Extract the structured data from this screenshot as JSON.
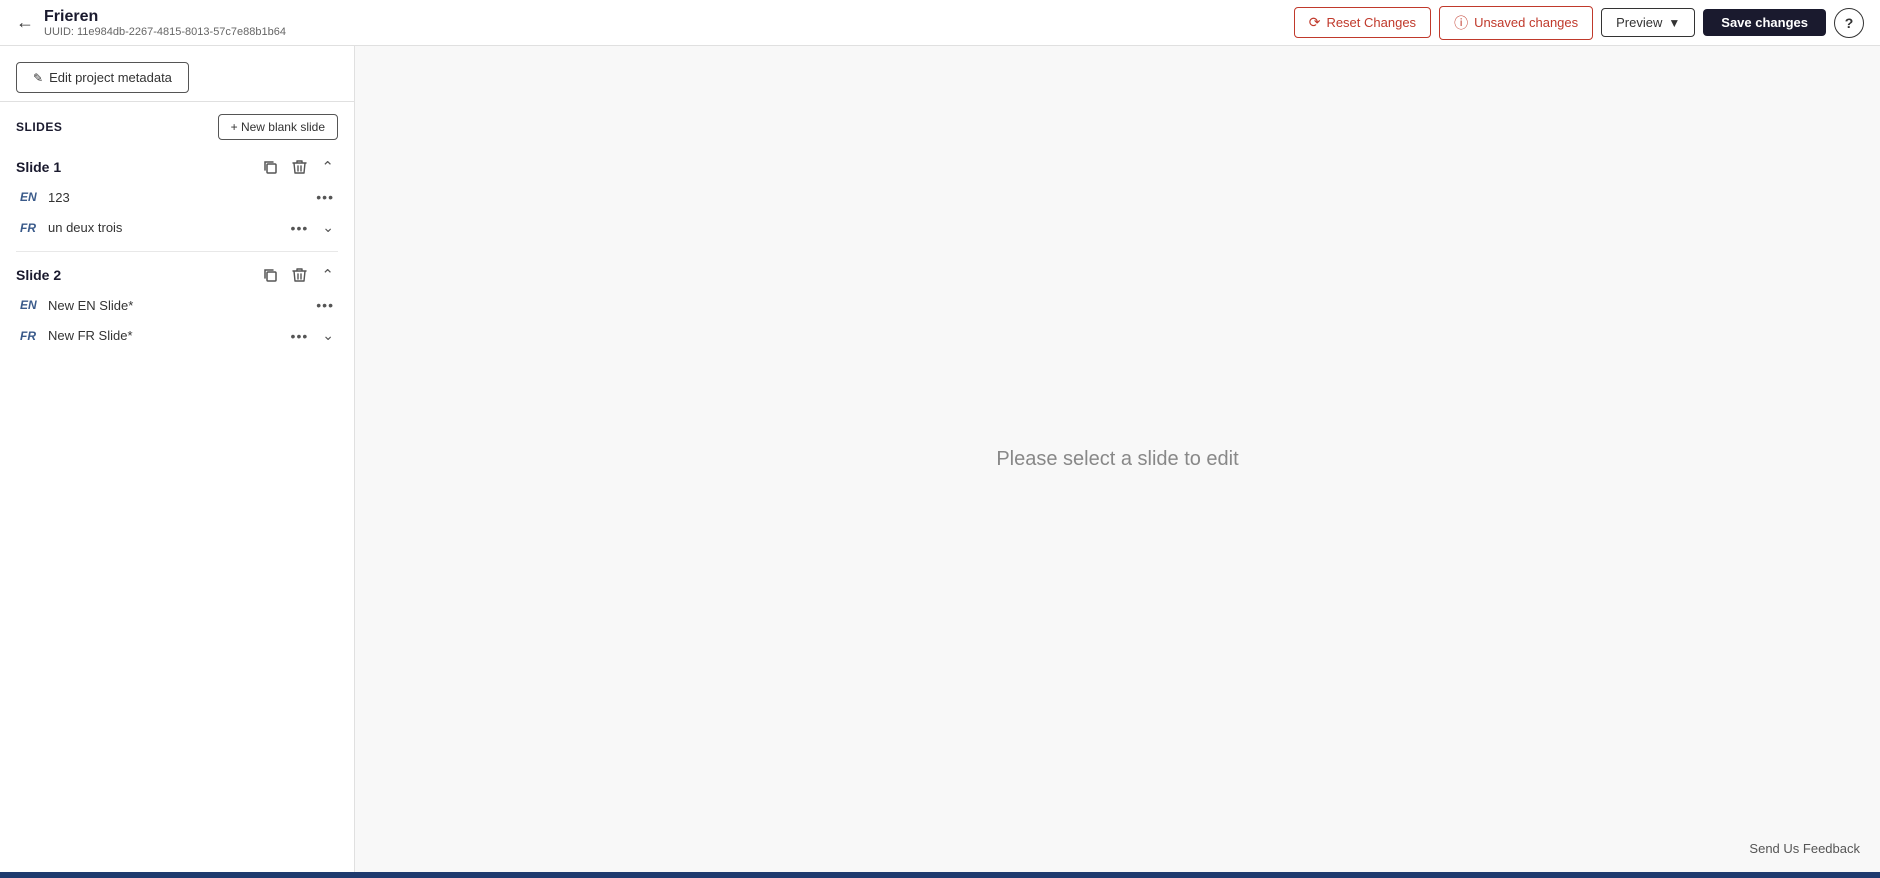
{
  "header": {
    "project_name": "Frieren",
    "project_uuid": "UUID: 11e984db-2267-4815-8013-57c7e88b1b64",
    "btn_reset_label": "Reset Changes",
    "btn_unsaved_label": "Unsaved changes",
    "btn_preview_label": "Preview",
    "btn_save_label": "Save changes",
    "btn_help_label": "?"
  },
  "sidebar": {
    "btn_edit_metadata_label": "Edit project metadata",
    "slides_section_label": "SLIDES",
    "btn_new_slide_label": "+ New blank slide",
    "slides": [
      {
        "name": "Slide 1",
        "languages": [
          {
            "tag": "EN",
            "content": "123",
            "has_chevron": false
          },
          {
            "tag": "FR",
            "content": "un deux trois",
            "has_chevron": true
          }
        ]
      },
      {
        "name": "Slide 2",
        "languages": [
          {
            "tag": "EN",
            "content": "New EN Slide*",
            "has_chevron": false
          },
          {
            "tag": "FR",
            "content": "New FR Slide*",
            "has_chevron": true
          }
        ]
      }
    ]
  },
  "editor": {
    "placeholder": "Please select a slide to edit",
    "feedback_label": "Send Us Feedback"
  }
}
